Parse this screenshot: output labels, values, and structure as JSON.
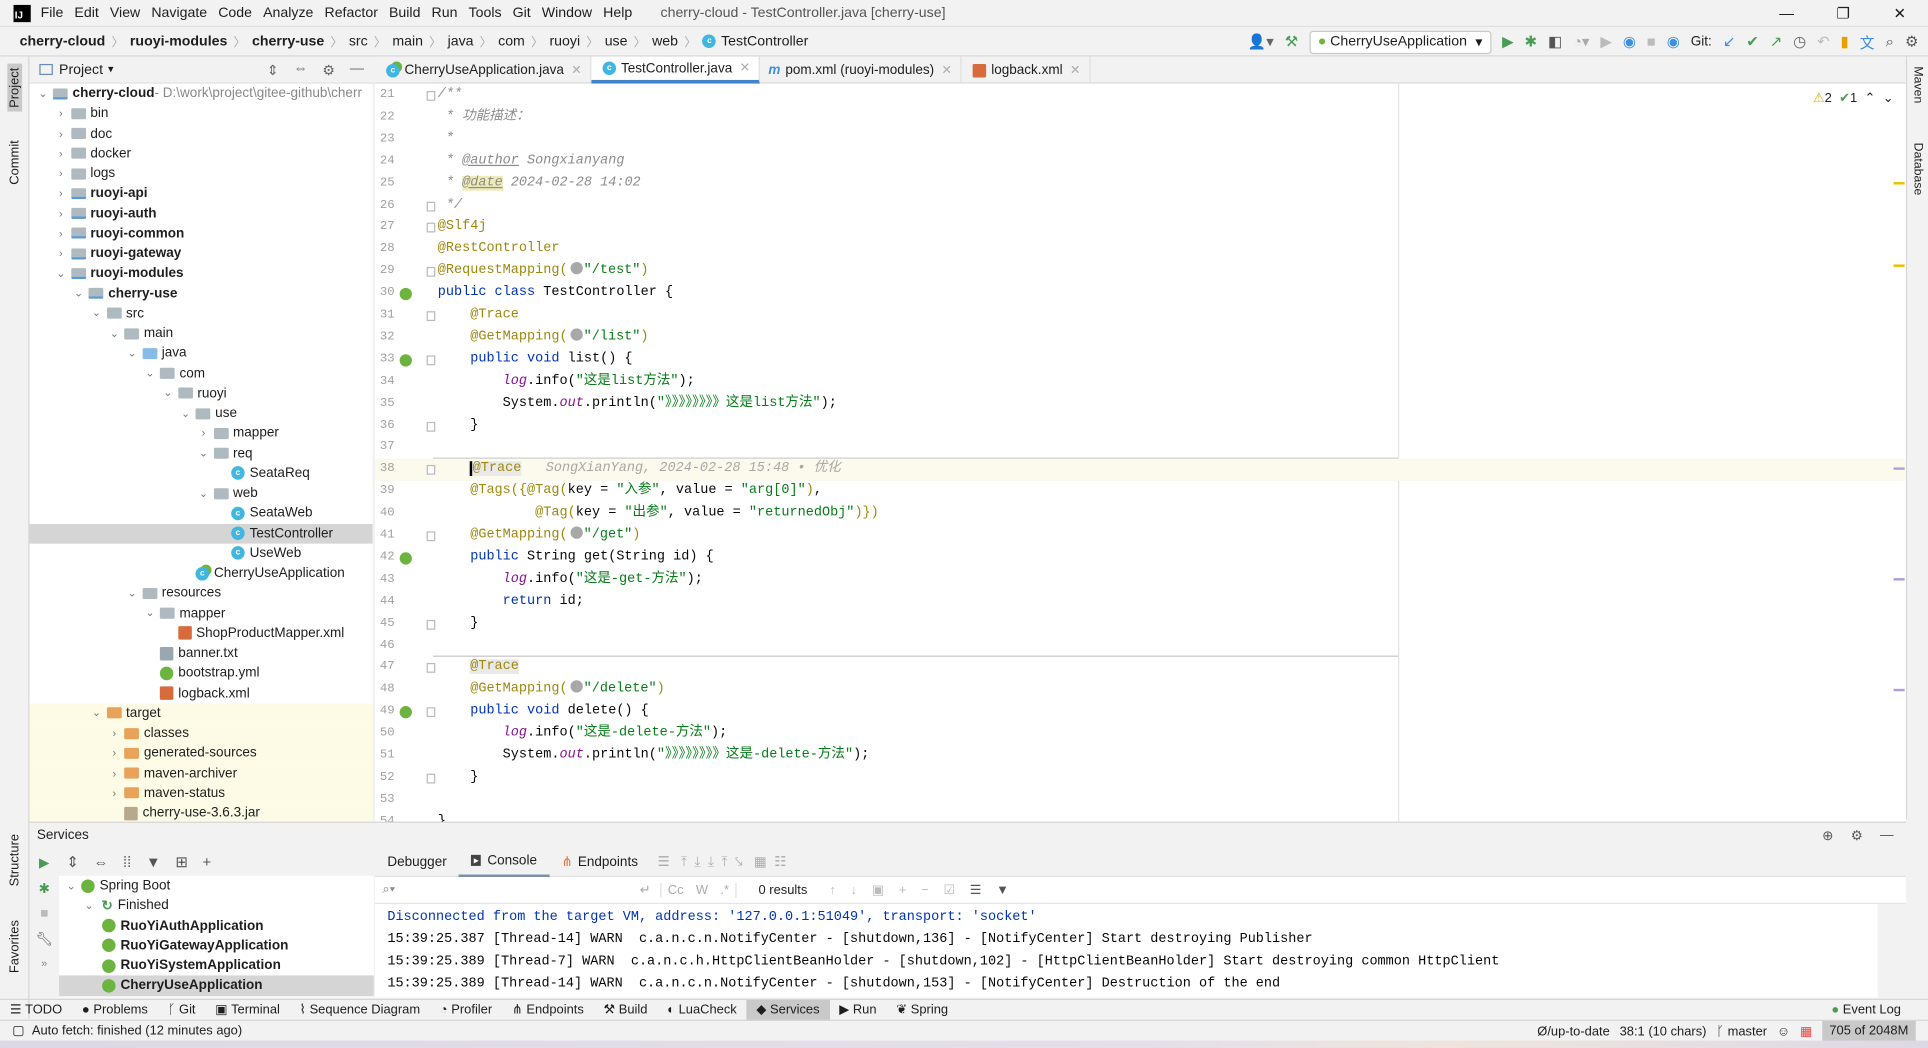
{
  "window": {
    "title": "cherry-cloud - TestController.java [cherry-use]",
    "logo": "IJ",
    "controls": [
      "—",
      "❐",
      "✕"
    ]
  },
  "menu": [
    "File",
    "Edit",
    "View",
    "Navigate",
    "Code",
    "Analyze",
    "Refactor",
    "Build",
    "Run",
    "Tools",
    "Git",
    "Window",
    "Help"
  ],
  "breadcrumb": [
    {
      "label": "cherry-cloud",
      "bold": true
    },
    {
      "label": "ruoyi-modules",
      "bold": true
    },
    {
      "label": "cherry-use",
      "bold": true
    },
    {
      "label": "src"
    },
    {
      "label": "main"
    },
    {
      "label": "java"
    },
    {
      "label": "com"
    },
    {
      "label": "ruoyi"
    },
    {
      "label": "use"
    },
    {
      "label": "web"
    },
    {
      "label": "TestController",
      "icon": "class"
    }
  ],
  "toolbar": {
    "run_config": "CherryUseApplication",
    "git_label": "Git:"
  },
  "left_strip": [
    "Project",
    "Commit",
    "Structure",
    "Favorites"
  ],
  "right_strip": [
    "Maven",
    "Database"
  ],
  "project": {
    "title": "Project",
    "tree": [
      {
        "d": 0,
        "label": "cherry-cloud",
        "suffix": " - D:\\work\\project\\gitee-github\\cherr",
        "type": "mod",
        "open": true,
        "bold": true
      },
      {
        "d": 1,
        "label": "bin",
        "type": "folder",
        "open": false
      },
      {
        "d": 1,
        "label": "doc",
        "type": "folder",
        "open": false
      },
      {
        "d": 1,
        "label": "docker",
        "type": "folder",
        "open": false
      },
      {
        "d": 1,
        "label": "logs",
        "type": "folder",
        "open": false
      },
      {
        "d": 1,
        "label": "ruoyi-api",
        "type": "mod",
        "open": false,
        "bold": true
      },
      {
        "d": 1,
        "label": "ruoyi-auth",
        "type": "mod",
        "open": false,
        "bold": true
      },
      {
        "d": 1,
        "label": "ruoyi-common",
        "type": "mod",
        "open": false,
        "bold": true
      },
      {
        "d": 1,
        "label": "ruoyi-gateway",
        "type": "mod",
        "open": false,
        "bold": true
      },
      {
        "d": 1,
        "label": "ruoyi-modules",
        "type": "mod",
        "open": true,
        "bold": true
      },
      {
        "d": 2,
        "label": "cherry-use",
        "type": "mod",
        "open": true,
        "bold": true
      },
      {
        "d": 3,
        "label": "src",
        "type": "folder",
        "open": true
      },
      {
        "d": 4,
        "label": "main",
        "type": "folder",
        "open": true
      },
      {
        "d": 5,
        "label": "java",
        "type": "blue",
        "open": true
      },
      {
        "d": 6,
        "label": "com",
        "type": "folder",
        "open": true
      },
      {
        "d": 7,
        "label": "ruoyi",
        "type": "folder",
        "open": true
      },
      {
        "d": 8,
        "label": "use",
        "type": "folder",
        "open": true
      },
      {
        "d": 9,
        "label": "mapper",
        "type": "folder",
        "open": false
      },
      {
        "d": 9,
        "label": "req",
        "type": "folder",
        "open": true
      },
      {
        "d": 10,
        "label": "SeataReq",
        "type": "class"
      },
      {
        "d": 9,
        "label": "web",
        "type": "folder",
        "open": true
      },
      {
        "d": 10,
        "label": "SeataWeb",
        "type": "class"
      },
      {
        "d": 10,
        "label": "TestController",
        "type": "class",
        "selected": true
      },
      {
        "d": 10,
        "label": "UseWeb",
        "type": "class"
      },
      {
        "d": 8,
        "label": "CherryUseApplication",
        "type": "app"
      },
      {
        "d": 5,
        "label": "resources",
        "type": "folder",
        "open": true
      },
      {
        "d": 6,
        "label": "mapper",
        "type": "folder",
        "open": true
      },
      {
        "d": 7,
        "label": "ShopProductMapper.xml",
        "type": "xml"
      },
      {
        "d": 6,
        "label": "banner.txt",
        "type": "txt"
      },
      {
        "d": 6,
        "label": "bootstrap.yml",
        "type": "yml"
      },
      {
        "d": 6,
        "label": "logback.xml",
        "type": "xml"
      },
      {
        "d": 3,
        "label": "target",
        "type": "orange",
        "open": true,
        "excluded": true
      },
      {
        "d": 4,
        "label": "classes",
        "type": "orange",
        "open": false,
        "excluded": true
      },
      {
        "d": 4,
        "label": "generated-sources",
        "type": "orange",
        "open": false,
        "excluded": true
      },
      {
        "d": 4,
        "label": "maven-archiver",
        "type": "orange",
        "open": false,
        "excluded": true
      },
      {
        "d": 4,
        "label": "maven-status",
        "type": "orange",
        "open": false,
        "excluded": true
      },
      {
        "d": 4,
        "label": "cherry-use-3.6.3.jar",
        "type": "jar",
        "excluded": true
      }
    ]
  },
  "editor_tabs": [
    {
      "label": "CherryUseApplication.java",
      "icon": "app"
    },
    {
      "label": "TestController.java",
      "icon": "class",
      "active": true
    },
    {
      "label": "pom.xml (ruoyi-modules)",
      "icon": "maven"
    },
    {
      "label": "logback.xml",
      "icon": "xml"
    }
  ],
  "inspections": {
    "warnings": "2",
    "weak_warnings": "1"
  },
  "code": [
    {
      "n": 21,
      "fold": true,
      "t": [
        [
          "/**",
          "cmt"
        ]
      ]
    },
    {
      "n": 22,
      "t": [
        [
          " * 功能描述：",
          "cmt"
        ]
      ]
    },
    {
      "n": 23,
      "t": [
        [
          " *",
          "cmt"
        ]
      ]
    },
    {
      "n": 24,
      "t": [
        [
          " * ",
          "cmt"
        ],
        [
          "@author",
          "doctag"
        ],
        [
          " Songxianyang",
          "cmt"
        ]
      ]
    },
    {
      "n": 25,
      "t": [
        [
          " * ",
          "cmt"
        ],
        [
          "@date",
          "doctag hl"
        ],
        [
          " 2024-02-28 14:02",
          "cmt"
        ]
      ]
    },
    {
      "n": 26,
      "fold": true,
      "t": [
        [
          " */",
          "cmt"
        ]
      ]
    },
    {
      "n": 27,
      "fold": true,
      "t": [
        [
          "@Slf4j",
          "ann"
        ]
      ]
    },
    {
      "n": 28,
      "t": [
        [
          "@RestController",
          "ann"
        ]
      ]
    },
    {
      "n": 29,
      "fold": true,
      "t": [
        [
          "@RequestMapping(",
          "ann"
        ],
        [
          "",
          "webicon"
        ],
        [
          "\"/test\"",
          "str"
        ],
        [
          ")",
          "ann"
        ]
      ]
    },
    {
      "n": 30,
      "bean": true,
      "t": [
        [
          "public class ",
          "kw"
        ],
        [
          "TestController {",
          "plain"
        ]
      ]
    },
    {
      "n": 31,
      "fold": true,
      "t": [
        [
          "    ",
          "plain"
        ],
        [
          "@Trace",
          "ann"
        ]
      ]
    },
    {
      "n": 32,
      "t": [
        [
          "    ",
          "plain"
        ],
        [
          "@GetMapping(",
          "ann"
        ],
        [
          "",
          "webicon"
        ],
        [
          "\"/list\"",
          "str"
        ],
        [
          ")",
          "ann"
        ]
      ]
    },
    {
      "n": 33,
      "bean": true,
      "fold": true,
      "t": [
        [
          "    ",
          "plain"
        ],
        [
          "public void ",
          "kw"
        ],
        [
          "list() {",
          "plain"
        ]
      ]
    },
    {
      "n": 34,
      "t": [
        [
          "        ",
          "plain"
        ],
        [
          "log",
          "field"
        ],
        [
          ".info(",
          "plain"
        ],
        [
          "\"这是list方法\"",
          "str"
        ],
        [
          ");",
          "plain"
        ]
      ]
    },
    {
      "n": 35,
      "t": [
        [
          "        ",
          "plain"
        ],
        [
          "System.",
          "plain"
        ],
        [
          "out",
          "field"
        ],
        [
          ".println(",
          "plain"
        ],
        [
          "\"》》》》》》》》这是list方法\"",
          "str"
        ],
        [
          ");",
          "plain"
        ]
      ]
    },
    {
      "n": 36,
      "fold": true,
      "t": [
        [
          "    }",
          "plain"
        ]
      ]
    },
    {
      "n": 37,
      "t": []
    },
    {
      "n": 38,
      "fold": true,
      "current": true,
      "t": [
        [
          "    ",
          "plain"
        ],
        [
          "@Trace",
          "ann annhl"
        ],
        [
          "   SongXianYang, 2024-02-28 15:48 • 优化",
          "blame"
        ]
      ]
    },
    {
      "n": 39,
      "t": [
        [
          "    ",
          "plain"
        ],
        [
          "@Tags({",
          "ann"
        ],
        [
          "@Tag(",
          "ann"
        ],
        [
          "key = ",
          "plain"
        ],
        [
          "\"入参\"",
          "str"
        ],
        [
          ", value = ",
          "plain"
        ],
        [
          "\"arg[0]\"",
          "str"
        ],
        [
          ")",
          "ann"
        ],
        [
          ",",
          "plain"
        ]
      ]
    },
    {
      "n": 40,
      "t": [
        [
          "            ",
          "plain"
        ],
        [
          "@Tag(",
          "ann"
        ],
        [
          "key = ",
          "plain"
        ],
        [
          "\"出参\"",
          "str"
        ],
        [
          ", value = ",
          "plain"
        ],
        [
          "\"returnedObj\"",
          "str"
        ],
        [
          ")})",
          "ann"
        ]
      ]
    },
    {
      "n": 41,
      "fold": true,
      "t": [
        [
          "    ",
          "plain"
        ],
        [
          "@GetMapping(",
          "ann"
        ],
        [
          "",
          "webicon"
        ],
        [
          "\"/get\"",
          "str"
        ],
        [
          ")",
          "ann"
        ]
      ]
    },
    {
      "n": 42,
      "bean": true,
      "t": [
        [
          "    ",
          "plain"
        ],
        [
          "public ",
          "kw"
        ],
        [
          "String get(String id) {",
          "plain"
        ]
      ]
    },
    {
      "n": 43,
      "t": [
        [
          "        ",
          "plain"
        ],
        [
          "log",
          "field"
        ],
        [
          ".info(",
          "plain"
        ],
        [
          "\"这是-get-方法\"",
          "str"
        ],
        [
          ");",
          "plain"
        ]
      ]
    },
    {
      "n": 44,
      "t": [
        [
          "        ",
          "plain"
        ],
        [
          "return ",
          "kw"
        ],
        [
          "id;",
          "plain"
        ]
      ]
    },
    {
      "n": 45,
      "fold": true,
      "t": [
        [
          "    }",
          "plain"
        ]
      ]
    },
    {
      "n": 46,
      "t": []
    },
    {
      "n": 47,
      "fold": true,
      "t": [
        [
          "    ",
          "plain"
        ],
        [
          "@Trace",
          "ann annhl"
        ]
      ]
    },
    {
      "n": 48,
      "t": [
        [
          "    ",
          "plain"
        ],
        [
          "@GetMapping(",
          "ann"
        ],
        [
          "",
          "webicon"
        ],
        [
          "\"/delete\"",
          "str"
        ],
        [
          ")",
          "ann"
        ]
      ]
    },
    {
      "n": 49,
      "bean": true,
      "fold": true,
      "t": [
        [
          "    ",
          "plain"
        ],
        [
          "public void ",
          "kw"
        ],
        [
          "delete() {",
          "plain"
        ]
      ]
    },
    {
      "n": 50,
      "t": [
        [
          "        ",
          "plain"
        ],
        [
          "log",
          "field"
        ],
        [
          ".info(",
          "plain"
        ],
        [
          "\"这是-delete-方法\"",
          "str"
        ],
        [
          ");",
          "plain"
        ]
      ]
    },
    {
      "n": 51,
      "t": [
        [
          "        ",
          "plain"
        ],
        [
          "System.",
          "plain"
        ],
        [
          "out",
          "field"
        ],
        [
          ".println(",
          "plain"
        ],
        [
          "\"》》》》》》》》这是-delete-方法\"",
          "str"
        ],
        [
          ");",
          "plain"
        ]
      ]
    },
    {
      "n": 52,
      "fold": true,
      "t": [
        [
          "    }",
          "plain"
        ]
      ]
    },
    {
      "n": 53,
      "t": []
    },
    {
      "n": 54,
      "t": [
        [
          "}",
          "plain"
        ]
      ]
    }
  ],
  "services": {
    "title": "Services",
    "tree": [
      {
        "d": 0,
        "label": "Spring Boot",
        "open": true
      },
      {
        "d": 1,
        "label": "Finished",
        "open": true
      },
      {
        "d": 2,
        "label": "RuoYiAuthApplication",
        "bold": true
      },
      {
        "d": 2,
        "label": "RuoYiGatewayApplication",
        "bold": true
      },
      {
        "d": 2,
        "label": "RuoYiSystemApplication",
        "bold": true
      },
      {
        "d": 2,
        "label": "CherryUseApplication",
        "bold": true,
        "selected": true
      }
    ],
    "tabs": [
      "Debugger",
      "Console",
      "Endpoints"
    ],
    "active_tab": "Console",
    "search_placeholder": "",
    "search_options": [
      "Cc",
      "W",
      ".*"
    ],
    "results": "0 results",
    "console": [
      {
        "text": "Disconnected from the target VM, address: '127.0.0.1:51049', transport: 'socket'",
        "color": "#0033b3"
      },
      {
        "text": "15:39:25.387 [Thread-14] WARN  c.a.n.c.n.NotifyCenter - [shutdown,136] - [NotifyCenter] Start destroying Publisher",
        "color": "#080808"
      },
      {
        "text": "15:39:25.389 [Thread-7] WARN  c.a.n.c.h.HttpClientBeanHolder - [shutdown,102] - [HttpClientBeanHolder] Start destroying common HttpClient",
        "color": "#080808"
      },
      {
        "text": "15:39:25.389 [Thread-14] WARN  c.a.n.c.n.NotifyCenter - [shutdown,153] - [NotifyCenter] Destruction of the end",
        "color": "#080808"
      }
    ]
  },
  "bottom_tabs": [
    {
      "label": "TODO",
      "icon": "☰"
    },
    {
      "label": "Problems",
      "icon": "●"
    },
    {
      "label": "Git",
      "icon": "ᚴ"
    },
    {
      "label": "Terminal",
      "icon": "▣"
    },
    {
      "label": "Sequence Diagram",
      "icon": "⌇"
    },
    {
      "label": "Profiler",
      "icon": "◔"
    },
    {
      "label": "Endpoints",
      "icon": "⋔"
    },
    {
      "label": "Build",
      "icon": "⚒"
    },
    {
      "label": "LuaCheck",
      "icon": "◐"
    },
    {
      "label": "Services",
      "icon": "◆",
      "active": true
    },
    {
      "label": "Run",
      "icon": "▶"
    },
    {
      "label": "Spring",
      "icon": "❦"
    }
  ],
  "event_log": "Event Log",
  "status": {
    "message": "Auto fetch: finished (12 minutes ago)",
    "vcs": "Ø/up-to-date",
    "position": "38:1 (10 chars)",
    "branch": "master",
    "memory": "705 of 2048M"
  },
  "colors": {
    "keyword": "#0033b3",
    "annotation": "#9e880d",
    "string": "#067d17",
    "comment": "#8c8c8c",
    "field": "#871094",
    "accent": "#4083c9"
  }
}
